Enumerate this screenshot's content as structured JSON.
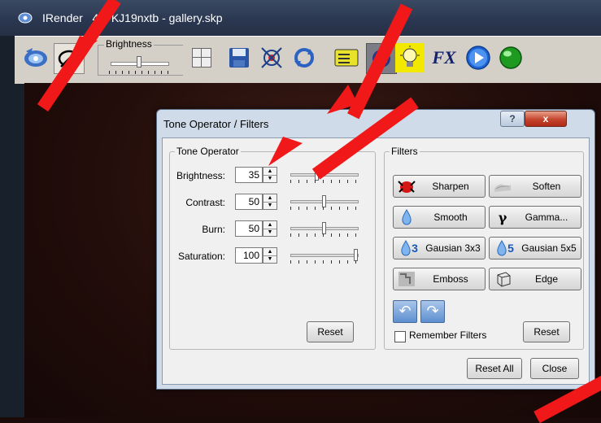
{
  "main_window": {
    "title": "IRender   4.0 KJ19nxtb - gallery.skp",
    "brightness_label": "Brightness"
  },
  "toolbar_icons": [
    "irender-logo-icon",
    "tone-operator-icon",
    "save-icon",
    "target-icon",
    "refresh-icon",
    "batch-icon",
    "earth-icon",
    "lightbulb-icon",
    "fx-icon",
    "play-icon",
    "green-ball-icon"
  ],
  "dialog": {
    "title": "Tone Operator / Filters",
    "help_label": "?",
    "close_label": "x",
    "tone_group_label": "Tone Operator",
    "filters_group_label": "Filters",
    "rows": [
      {
        "label": "Brightness:",
        "value": "35",
        "level": 0.38
      },
      {
        "label": "Contrast:",
        "value": "50",
        "level": 0.5
      },
      {
        "label": "Burn:",
        "value": "50",
        "level": 0.5
      },
      {
        "label": "Saturation:",
        "value": "100",
        "level": 1.0
      }
    ],
    "tone_reset": "Reset",
    "filters": {
      "sharpen": "Sharpen",
      "soften": "Soften",
      "smooth": "Smooth",
      "gamma": "Gamma...",
      "gaussian3": "Gausian 3x3",
      "gaussian5": "Gausian 5x5",
      "emboss": "Emboss",
      "edge": "Edge"
    },
    "filter_icons": {
      "gamma": "γ",
      "gaussian3_num": "3",
      "gaussian5_num": "5"
    },
    "remember_label": "Remember Filters",
    "remember_checked": false,
    "filters_reset": "Reset",
    "reset_all": "Reset All",
    "close_button": "Close"
  },
  "colors": {
    "arrow": "#f01818",
    "title_bar": "#2a3650",
    "dialog_frame": "#cfdbe8"
  }
}
